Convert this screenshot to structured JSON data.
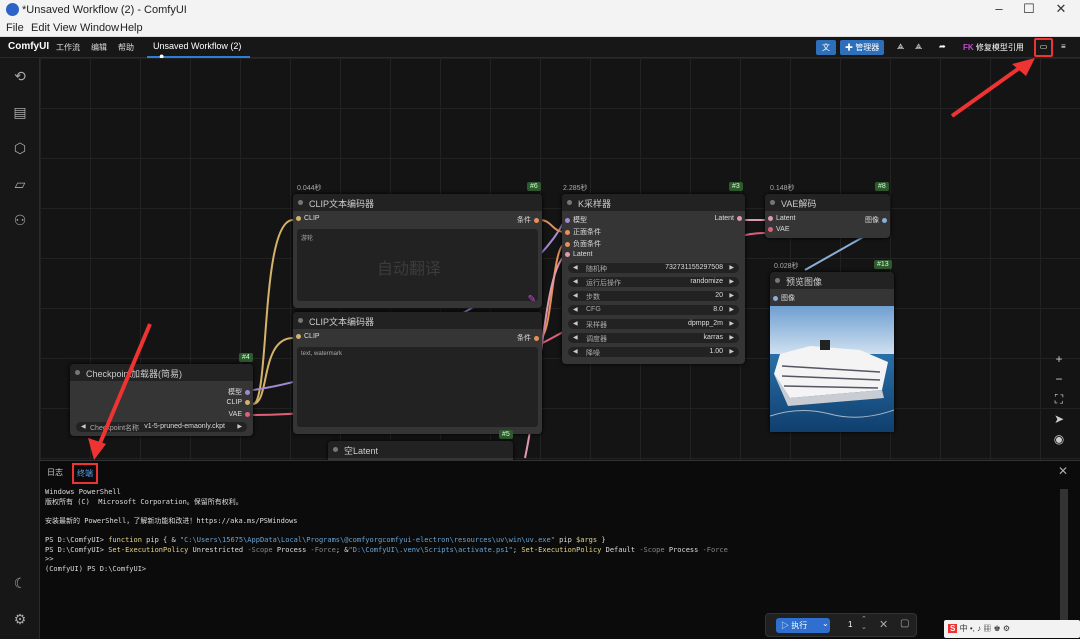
{
  "window": {
    "title": "*Unsaved Workflow (2) - ComfyUI",
    "minimize": "–",
    "maximize": "☐",
    "close": "✕"
  },
  "menubar": [
    "File",
    "Edit",
    "View",
    "Window",
    "Help"
  ],
  "header": {
    "logo": "ComfyUI",
    "menus": [
      "工作流",
      "编辑",
      "帮助"
    ],
    "tab": "Unsaved Workflow (2)",
    "manager": "管理器",
    "fix_models": "修复模型引用"
  },
  "nodes": {
    "clip1": {
      "time": "0.044秒",
      "badge": "#6",
      "title": "CLIP文本编码器",
      "in": "CLIP",
      "out": "条件",
      "text": "游轮",
      "overlay": "自动翻译"
    },
    "clip2": {
      "title": "CLIP文本编码器",
      "in": "CLIP",
      "out": "条件",
      "text": "text, watermark"
    },
    "ksampler": {
      "time": "2.285秒",
      "badge": "#3",
      "title": "K采样器",
      "inputs": [
        "模型",
        "正面条件",
        "负面条件",
        "Latent"
      ],
      "out": "Latent",
      "widgets": [
        {
          "label": "随机种",
          "value": "732731155297508"
        },
        {
          "label": "运行后操作",
          "value": "randomize"
        },
        {
          "label": "步数",
          "value": "20"
        },
        {
          "label": "CFG",
          "value": "8.0"
        },
        {
          "label": "采样器",
          "value": "dpmpp_2m"
        },
        {
          "label": "调度器",
          "value": "karras"
        },
        {
          "label": "降噪",
          "value": "1.00"
        }
      ]
    },
    "vae": {
      "time": "0.148秒",
      "badge": "#8",
      "title": "VAE解码",
      "in1": "Latent",
      "in2": "VAE",
      "out": "图像"
    },
    "preview": {
      "time": "0.028秒",
      "badge": "#13",
      "title": "预览图像",
      "in": "图像"
    },
    "checkpoint": {
      "badge": "#4",
      "title": "Checkpoint加载器(简易)",
      "outs": [
        "模型",
        "CLIP",
        "VAE"
      ],
      "widget_label": "Checkpoint名称",
      "widget_value": "v1-5-pruned-emaonly.ckpt"
    },
    "latent": {
      "badge": "#5",
      "title": "空Latent"
    }
  },
  "panel": {
    "tabs": [
      "日志",
      "终端"
    ],
    "terminal": {
      "l1": "Windows PowerShell",
      "l2": "版权所有 (C)  Microsoft Corporation。保留所有权利。",
      "l3": "安装最新的 PowerShell，了解新功能和改进！https://aka.ms/PSWindows",
      "l4a": "PS D:\\ComfyUI> ",
      "l4b": "function",
      "l4c": " pip { & ",
      "l4d": "\"C:\\Users\\15675\\AppData\\Local\\Programs\\@comfyorgcomfyui-electron\\resources\\uv\\win\\uv.exe\"",
      "l4e": " pip ",
      "l4f": "$args",
      "l4g": " }",
      "l5a": "PS D:\\ComfyUI> ",
      "l5b": "Set-ExecutionPolicy",
      "l5c": " Unrestricted ",
      "l5d": "-Scope",
      "l5e": " Process ",
      "l5f": "-Force",
      "l5g": "; &",
      "l5h": "\"D:\\ComfyUI\\.venv\\Scripts\\activate.ps1\"",
      "l5i": "; ",
      "l5j": "Set-ExecutionPolicy",
      "l5k": " Default ",
      "l5l": "-Scope",
      "l5m": " Process ",
      "l5n": "-Force",
      "l6": ">>",
      "l7": "(ComfyUI) PS D:\\ComfyUI>"
    }
  },
  "runbar": {
    "run": "执行",
    "count": "1"
  },
  "taskbar": {
    "ime": "中"
  }
}
